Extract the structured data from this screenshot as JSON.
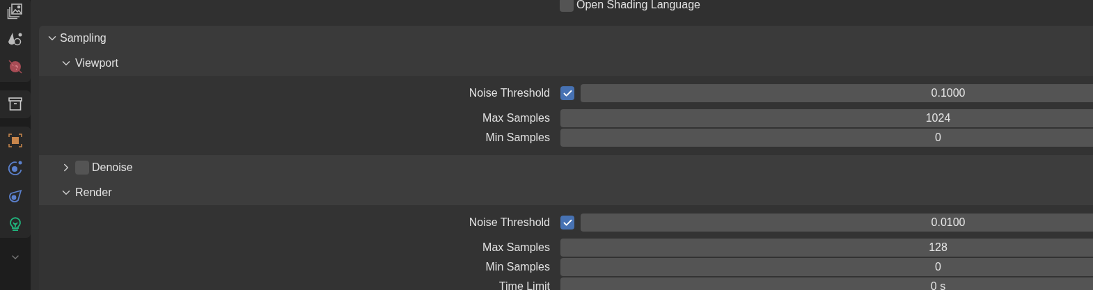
{
  "top_option": {
    "label": "Open Shading Language",
    "checked": false
  },
  "panel": {
    "title": "Sampling",
    "expanded": true,
    "subpanels": [
      {
        "title": "Viewport",
        "expanded": true,
        "rows": [
          {
            "label": "Noise Threshold",
            "checked": true,
            "value": "0.1000"
          },
          {
            "label": "Max Samples",
            "value": "1024"
          },
          {
            "label": "Min Samples",
            "value": "0"
          }
        ]
      },
      {
        "title": "Denoise",
        "expanded": false,
        "checked": false
      },
      {
        "title": "Render",
        "expanded": true,
        "rows": [
          {
            "label": "Noise Threshold",
            "checked": true,
            "value": "0.0100"
          },
          {
            "label": "Max Samples",
            "value": "128"
          },
          {
            "label": "Min Samples",
            "value": "0"
          },
          {
            "label": "Time Limit",
            "value": "0 s"
          }
        ]
      }
    ]
  }
}
